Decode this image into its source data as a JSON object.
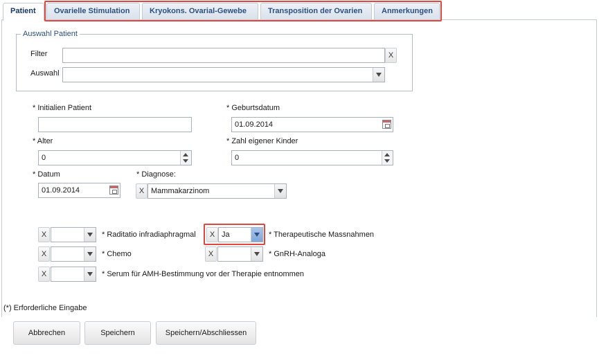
{
  "tabs": [
    {
      "label": "Patient",
      "active": true
    },
    {
      "label": "Ovarielle Stimulation",
      "active": false
    },
    {
      "label": "Kryokons. Ovarial-Gewebe",
      "active": false
    },
    {
      "label": "Transposition der Ovarien",
      "active": false
    },
    {
      "label": "Anmerkungen",
      "active": false
    }
  ],
  "patient_select": {
    "legend": "Auswahl Patient",
    "filter_label": "Filter",
    "filter_value": "",
    "clear_label": "X",
    "auswahl_label": "Auswahl",
    "auswahl_value": ""
  },
  "form": {
    "initialen_label": "* Initialien Patient",
    "initialen_value": "",
    "geburtsdatum_label": "* Geburtsdatum",
    "geburtsdatum_value": "01.09.2014",
    "alter_label": "* Alter",
    "alter_value": "0",
    "kinder_label": "* Zahl eigener Kinder",
    "kinder_value": "0",
    "datum_label": "* Datum",
    "datum_value": "01.09.2014",
    "diagnose_label": "* Diagnose:",
    "diagnose_value": "Mammakarzinom",
    "clear_label": "X"
  },
  "therapy": {
    "radiatio_label": "* Raditatio infradiaphragmal",
    "radiatio_value": "",
    "therapeutische_label": "* Therapeutische Massnahmen",
    "therapeutische_value": "Ja",
    "chemo_label": "* Chemo",
    "chemo_value": "",
    "gnrh_label": "* GnRH-Analoga",
    "gnrh_value": "",
    "serum_label": "* Serum für AMH-Bestimmung vor der Therapie entnommen",
    "serum_value": "",
    "clear_label": "X"
  },
  "required_note": "(*) Erforderliche Eingabe",
  "buttons": {
    "cancel": "Abbrechen",
    "save": "Speichern",
    "save_close": "Speichern/Abschliessen"
  },
  "colors": {
    "highlight": "#e0463d",
    "tab_text": "#2b4f82"
  }
}
